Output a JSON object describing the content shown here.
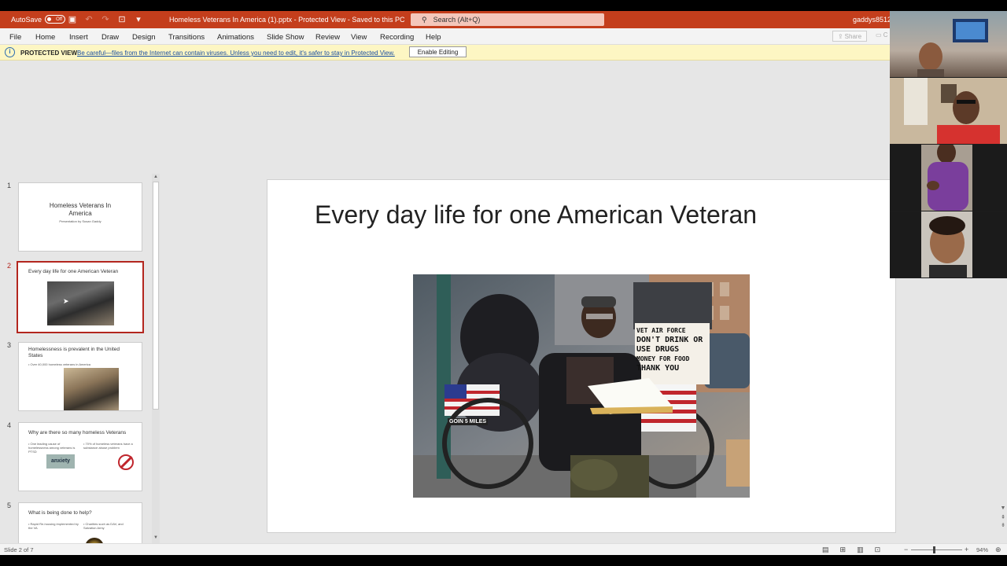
{
  "titlebar": {
    "autosave_label": "AutoSave",
    "autosave_state": "Off",
    "document_title": "Homeless Veterans In America (1).pptx  -  Protected View  -  Saved to this PC",
    "search_placeholder": "Search (Alt+Q)",
    "username": "gaddys8512"
  },
  "ribbon": {
    "tabs": [
      "File",
      "Home",
      "Insert",
      "Draw",
      "Design",
      "Transitions",
      "Animations",
      "Slide Show",
      "Review",
      "View",
      "Recording",
      "Help"
    ],
    "share_label": "Share"
  },
  "protected_view": {
    "label": "PROTECTED VIEW",
    "message": "Be careful—files from the Internet can contain viruses. Unless you need to edit, it's safer to stay in Protected View.",
    "enable_button": "Enable Editing"
  },
  "thumbnails": [
    {
      "number": "1",
      "title": "Homeless Veterans In America",
      "subtitle": "Presentation by Susan Gaddy"
    },
    {
      "number": "2",
      "title": "Every day life for one American Veteran"
    },
    {
      "number": "3",
      "title": "Homelessness is prevalent in the United States",
      "bullet": "• Over 40,000 homeless veterans in America"
    },
    {
      "number": "4",
      "title": "Why are there so many homeless Veterans",
      "bullet_left": "• One leading cause of homelessness among veterans is PTSD",
      "bullet_right": "• 70% of homeless veterans have a substance abuse problem",
      "word_art": "anxiety"
    },
    {
      "number": "5",
      "title": "What is being done to help?",
      "bullet_left": "• Rapid Re-housing implemented by the VA",
      "bullet_right": "• Charities such as DAV, and Salvation Army"
    }
  ],
  "selected_slide": 2,
  "slide": {
    "title": "Every day life for one American Veteran",
    "photo_signs": [
      "VET AIR FORCE",
      "DON'T DRINK OR",
      "USE DRUGS",
      "MONEY FOR FOOD",
      "THANK YOU",
      "GOIN 5 MILES"
    ]
  },
  "status": {
    "slide_info": "Slide 2 of 7",
    "zoom": "94%"
  },
  "colors": {
    "accent": "#c43e1c",
    "selected_border": "#b3261e",
    "protected_bg": "#fdf6c3"
  }
}
